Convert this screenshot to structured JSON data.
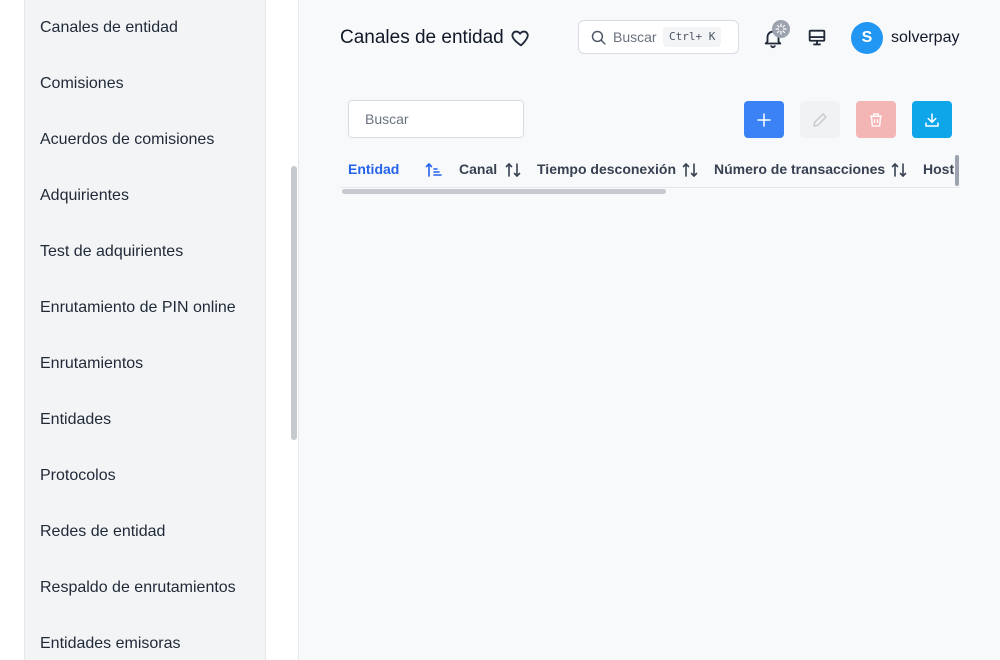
{
  "sidebar": {
    "items": [
      {
        "label": "Canales de entidad"
      },
      {
        "label": "Comisiones"
      },
      {
        "label": "Acuerdos de comisiones"
      },
      {
        "label": "Adquirientes"
      },
      {
        "label": "Test de adquirientes"
      },
      {
        "label": "Enrutamiento de PIN online"
      },
      {
        "label": "Enrutamientos"
      },
      {
        "label": "Entidades"
      },
      {
        "label": "Protocolos"
      },
      {
        "label": "Redes de entidad"
      },
      {
        "label": "Respaldo de enrutamientos"
      },
      {
        "label": "Entidades emisoras"
      }
    ]
  },
  "header": {
    "title": "Canales de entidad",
    "search": {
      "placeholder": "Buscar",
      "shortcut": "Ctrl+ K"
    },
    "user": {
      "initial": "S",
      "name": "solverpay"
    }
  },
  "toolbar": {
    "search_placeholder": "Buscar"
  },
  "table": {
    "columns": [
      {
        "label": "Entidad",
        "sort": "ascending"
      },
      {
        "label": "Canal",
        "sort": "none"
      },
      {
        "label": "Tiempo desconexión",
        "sort": "none"
      },
      {
        "label": "Número de transacciones",
        "sort": "none"
      },
      {
        "label": "Host",
        "sort": "none"
      }
    ]
  },
  "colors": {
    "primary": "#3b82f6",
    "danger_disabled": "#f4b5b5",
    "info": "#0ea5e9",
    "avatar": "#2196f3",
    "active_column": "#2563eb"
  }
}
